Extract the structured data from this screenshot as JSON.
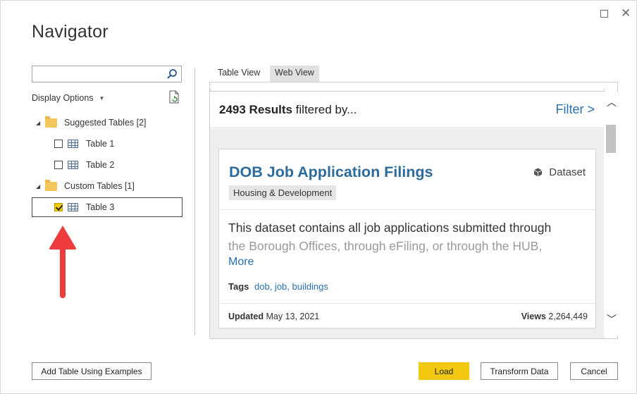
{
  "window": {
    "title": "Navigator",
    "maximize_icon": "maximize-icon",
    "close_icon": "close-icon"
  },
  "left_panel": {
    "search": {
      "value": "",
      "placeholder": ""
    },
    "display_options_label": "Display Options",
    "tree": [
      {
        "type": "folder",
        "label": "Suggested Tables [2]",
        "expanded": true
      },
      {
        "type": "table",
        "label": "Table 1",
        "checked": false
      },
      {
        "type": "table",
        "label": "Table 2",
        "checked": false
      },
      {
        "type": "folder",
        "label": "Custom Tables [1]",
        "expanded": true
      },
      {
        "type": "table",
        "label": "Table 3",
        "checked": true,
        "selected": true
      }
    ],
    "annotation_arrow_color": "#ee3b3b"
  },
  "tabs": [
    {
      "label": "Table View",
      "active": true
    },
    {
      "label": "Web View",
      "active": false
    }
  ],
  "web_view": {
    "results_count": "2493 Results",
    "results_suffix": " filtered by...",
    "filter_label": "Filter >",
    "card": {
      "title": "DOB Job Application Filings",
      "type_label": "Dataset",
      "category": "Housing & Development",
      "description_line1": "This dataset contains all job applications submitted through",
      "description_line2": "the Borough Offices, through eFiling, or through the HUB,",
      "more_label": "More",
      "tags_label": "Tags",
      "tags_value": "dob, job, buildings",
      "updated_label": "Updated",
      "updated_value": "May 13, 2021",
      "views_label": "Views",
      "views_value": "2,264,449"
    }
  },
  "buttons": {
    "add_table": "Add Table Using Examples",
    "load": "Load",
    "transform": "Transform Data",
    "cancel": "Cancel"
  },
  "colors": {
    "accent_yellow": "#f2c811",
    "link_blue": "#2a6fae"
  }
}
